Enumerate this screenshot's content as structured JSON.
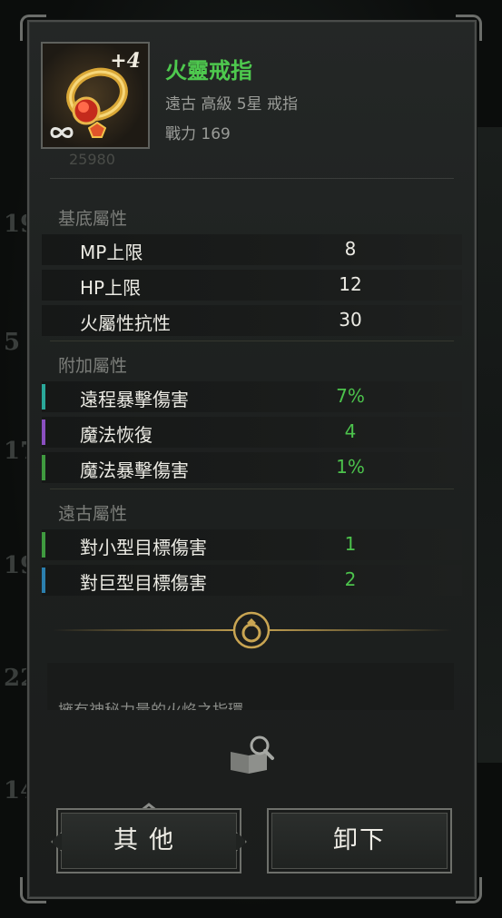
{
  "background": {
    "side_numbers": [
      "19",
      "5",
      "17",
      "19",
      "22",
      "14"
    ]
  },
  "item": {
    "enhance_level": "+4",
    "name": "火靈戒指",
    "meta": "遠古 高級 5星 戒指",
    "power": "戰力 169",
    "id_text": "25980",
    "icon": "fire-ring-icon",
    "name_color": "#4ec94e"
  },
  "base_stats": {
    "title": "基底屬性",
    "rows": [
      {
        "label": "MP上限",
        "value": "8"
      },
      {
        "label": "HP上限",
        "value": "12"
      },
      {
        "label": "火屬性抗性",
        "value": "30"
      }
    ]
  },
  "extra_stats": {
    "title": "附加屬性",
    "rows": [
      {
        "label": "遠程暴擊傷害",
        "value": "7%",
        "accent": "#2aa89a"
      },
      {
        "label": "魔法恢復",
        "value": "4",
        "accent": "#8a4fc0"
      },
      {
        "label": "魔法暴擊傷害",
        "value": "1%",
        "accent": "#3f9a3f"
      }
    ]
  },
  "ancient_stats": {
    "title": "遠古屬性",
    "rows": [
      {
        "label": "對小型目標傷害",
        "value": "1",
        "accent": "#3f9a3f"
      },
      {
        "label": "對巨型目標傷害",
        "value": "2",
        "accent": "#2b7fae"
      }
    ]
  },
  "description": {
    "text": "擁有神秘力量的火焰之指環"
  },
  "buttons": {
    "other": "其他",
    "unequip": "卸下"
  },
  "colors": {
    "value_green": "#4cc34c",
    "gold": "#c9a552"
  }
}
